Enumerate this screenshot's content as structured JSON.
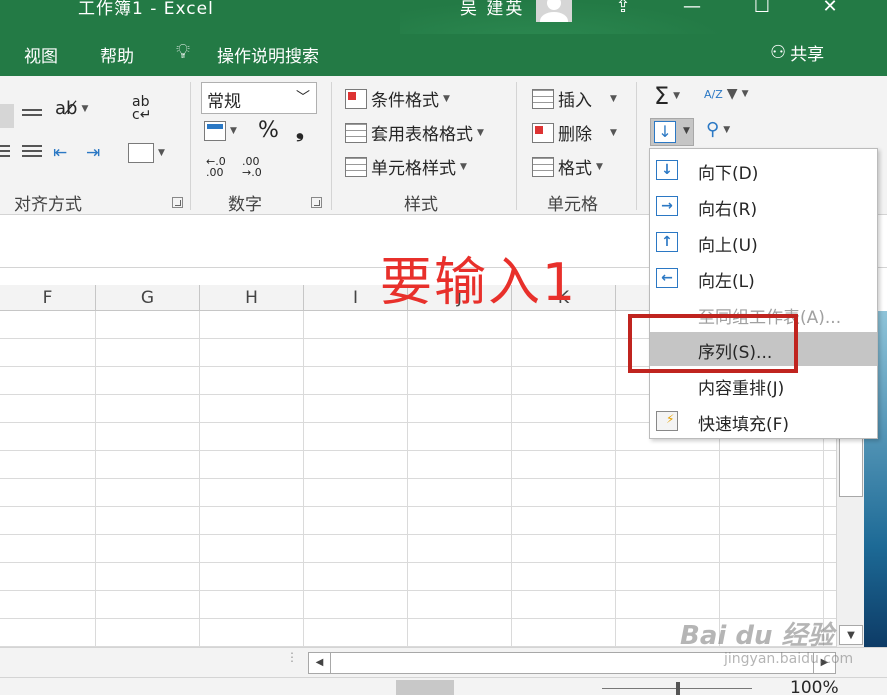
{
  "titlebar": {
    "title": "工作簿1  -  Excel",
    "user": "吴 建英",
    "restore_icon": "ribbon-display-icon",
    "minimize": "—",
    "maximize": "☐",
    "close": "✕"
  },
  "tabs": [
    {
      "label": "视图"
    },
    {
      "label": "帮助"
    },
    {
      "label": "操作说明搜索"
    }
  ],
  "share_label": "共享",
  "ribbon": {
    "groups": {
      "alignment": "对齐方式",
      "number": "数字",
      "styles": "样式",
      "cells": "单元格"
    },
    "number_format": "常规",
    "percent": "%",
    "comma": "❟",
    "conditional_format": "条件格式",
    "table_format": "套用表格格式",
    "cell_styles": "单元格样式",
    "insert": "插入",
    "delete": "删除",
    "format": "格式",
    "sigma": "Σ",
    "sort_az": "A/Z"
  },
  "columns": [
    "F",
    "G",
    "H",
    "I",
    "J",
    "K"
  ],
  "fill_menu": {
    "items": [
      {
        "label": "向下(D)",
        "arrow": "↓",
        "state": "normal"
      },
      {
        "label": "向右(R)",
        "arrow": "→",
        "state": "normal"
      },
      {
        "label": "向上(U)",
        "arrow": "↑",
        "state": "normal"
      },
      {
        "label": "向左(L)",
        "arrow": "←",
        "state": "normal"
      },
      {
        "label": "至同组工作表(A)...",
        "arrow": "",
        "state": "disabled"
      },
      {
        "label": "序列(S)...",
        "arrow": "",
        "state": "highlighted"
      },
      {
        "label": "内容重排(J)",
        "arrow": "",
        "state": "normal"
      },
      {
        "label": "快速填充(F)",
        "arrow": "",
        "state": "normal"
      }
    ]
  },
  "annotation": "要输入1",
  "zoom": "100%",
  "watermark": {
    "brand": "Bai  du 经验",
    "url": "jingyan.baidu.com"
  },
  "colors": {
    "excel_green": "#237a45",
    "annotation_red": "#e8302b",
    "box_red": "#c0241f",
    "accent_blue": "#2b78c4"
  }
}
